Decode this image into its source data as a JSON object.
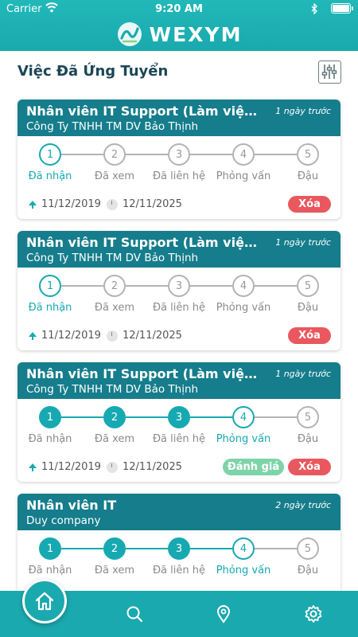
{
  "status_bar": {
    "carrier": "Carrier",
    "time": "9:20 AM"
  },
  "app": {
    "brand": "WEXYM"
  },
  "page": {
    "title": "Việc Đã Ứng Tuyển"
  },
  "colors": {
    "primary": "#1aa9ae",
    "header": "#157d8c",
    "delete": "#e9585e",
    "rate": "#7ed4a8"
  },
  "steps": [
    "Đã nhận",
    "Đã xem",
    "Đã liên hệ",
    "Phỏng vấn",
    "Đậu"
  ],
  "applications": [
    {
      "title": "Nhân viên IT Support (Làm việc...",
      "company": "Công Ty TNHH TM DV Bảo Thịnh",
      "posted": "1 ngày trước",
      "current_step": 1,
      "applied_date": "11/12/2019",
      "deadline": "12/11/2025",
      "actions": {
        "delete": "Xóa"
      }
    },
    {
      "title": "Nhân viên IT Support (Làm việc...",
      "company": "Công Ty TNHH TM DV Bảo Thịnh",
      "posted": "1 ngày trước",
      "current_step": 1,
      "applied_date": "11/12/2019",
      "deadline": "12/11/2025",
      "actions": {
        "delete": "Xóa"
      }
    },
    {
      "title": "Nhân viên IT Support (Làm việc...",
      "company": "Công Ty TNHH TM DV Bảo Thịnh",
      "posted": "1 ngày trước",
      "current_step": 4,
      "applied_date": "11/12/2019",
      "deadline": "12/11/2025",
      "actions": {
        "rate": "Đánh giá",
        "delete": "Xóa"
      }
    },
    {
      "title": "Nhân viên IT",
      "company": "Duy company",
      "posted": "2 ngày trước",
      "current_step": 4,
      "applied_date": "",
      "deadline": "",
      "actions": {}
    }
  ],
  "tabbar": {
    "items": [
      {
        "icon": "home-icon",
        "active": true
      },
      {
        "icon": "search-icon",
        "active": false
      },
      {
        "icon": "location-pin-icon",
        "active": false
      },
      {
        "icon": "gear-icon",
        "active": false
      }
    ]
  }
}
